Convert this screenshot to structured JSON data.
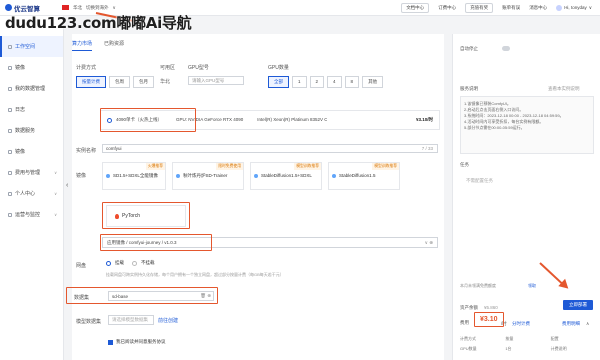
{
  "watermark": "dudu123.com嘟嘟Ai导航",
  "topbar": {
    "logo": "优云智算",
    "region": "华北",
    "account": "切换到海外",
    "nav": [
      "文档中心",
      "订费中心",
      "充值有奖",
      "账单有误",
      "消息中心"
    ],
    "user": "Hi, tonyday"
  },
  "sidebar": {
    "items": [
      {
        "label": "工作空间",
        "active": true
      },
      {
        "label": "镜像"
      },
      {
        "label": "我的数据管理"
      },
      {
        "label": "日志"
      },
      {
        "label": "数据服务"
      },
      {
        "label": "镜像"
      },
      {
        "label": "费用与管理",
        "chev": "∨"
      },
      {
        "label": "个人中心",
        "chev": "∨"
      },
      {
        "label": "运营与监控",
        "chev": "∨"
      }
    ]
  },
  "tabs": [
    "算力市场",
    "已购资源"
  ],
  "form": {
    "billing_label": "计费方式",
    "billing_options": [
      "按量计费",
      "包周",
      "包月"
    ],
    "zone_label": "可用区",
    "zone_value": "华北",
    "gpu_model_label": "GPU型号",
    "gpu_model_placeholder": "请输入GPU型号",
    "gpu_count_label": "GPU数量",
    "gpu_count_options": [
      "全部",
      "1",
      "2",
      "4",
      "8",
      "其他"
    ],
    "gpu_row": {
      "name": "4090单卡（火热上线）",
      "gpu": "GPU: NVIDIA GeForce RTX 4090",
      "cpu": "Intel(R) Xeon(R) Platinum 8352V CPU @ 2.10GHz",
      "price": "¥3.10/时"
    },
    "instance_label": "实例名称",
    "instance_value": "comfyui",
    "instance_count": "7 / 33",
    "image_label": "镜像",
    "images": [
      {
        "tag": "火爆推荐",
        "name": "SD1.5+SDXL全能镜像"
      },
      {
        "tag": "限时免费使用",
        "name": "秋叶炼丹炉SD-Trainer"
      },
      {
        "tag": "模型训练推荐",
        "name": "StableDiffusion1.5+SDXL"
      },
      {
        "tag": "模型训练推荐",
        "name": "StableDiffusion1.5"
      }
    ],
    "pytorch": "PyTorch",
    "path_value": "应用镜像 / comfyui-journey / v1.0.3",
    "path_trail": "∨  ⊕",
    "disk_label": "网盘",
    "disk_options": [
      "挂载",
      "不挂载"
    ],
    "disk_hint": "挂载网盘可跨实例持久化存储，每个用户拥有一个独立网盘，超过部分按量计费（每GB每天若干元）",
    "dataset_label": "数据集",
    "dataset_value": "sd-base",
    "dataset_trail": "🗑 ⊕",
    "model_label": "模型数据集",
    "model_placeholder": "请选择模型数据集",
    "model_link": "前往创建",
    "agree": "我已阅读并同意服务协议"
  },
  "right": {
    "auto_stop": "自动停止",
    "desc_title": "服务说明",
    "desc_link": "查看本实例说明",
    "desc_lines": [
      "1.该镜像已预装ComfyUI。",
      "2.启动后点击页面右侧入口访问。",
      "3.系统时间：2023-12-18 00:00 - 2023-12-18 04:59:59。",
      "4.活动时间内可享受折扣，每台实例有限额。",
      "5.部分节点需在00:00-05:59运行。"
    ],
    "tasks_title": "任务",
    "tasks_empty": "不需配置任务",
    "status_note": "本月未领满免费额度",
    "status_link": "领取",
    "deploy": "立即部署",
    "cost_label": "资产余额",
    "cost_value": "¥5.860",
    "price_label": "费用",
    "price_value": "¥3.10",
    "price_unit": "/时",
    "price_link": "分时计费",
    "detail_link": "费用明细",
    "bottom": [
      "计费方式",
      "按量",
      "配置",
      "GPU数量",
      "1台",
      "计费说明"
    ]
  }
}
